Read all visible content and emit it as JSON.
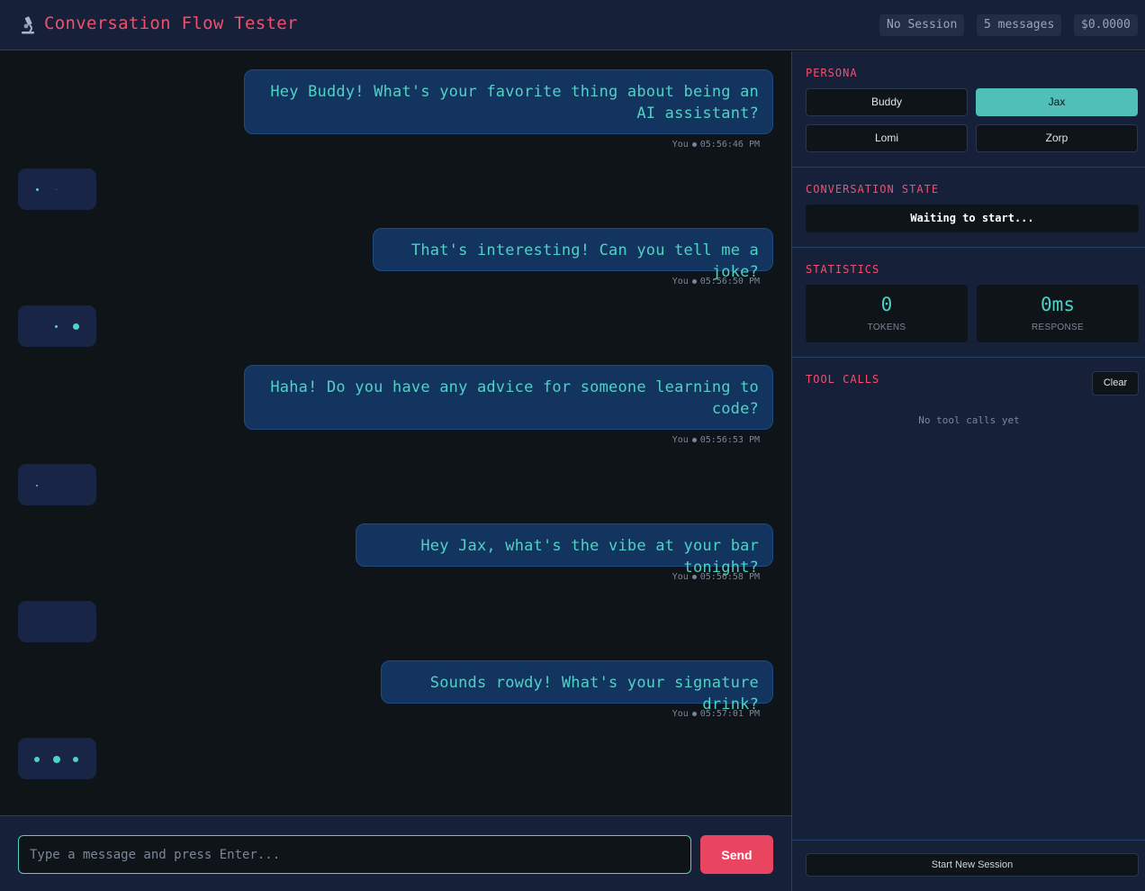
{
  "app": {
    "title": "Conversation Flow Tester",
    "logo_icon": "microscope-icon"
  },
  "header": {
    "session": "No Session",
    "messages": "5 messages",
    "cost": "$0.0000"
  },
  "chat": {
    "messages": [
      {
        "text": "Hey Buddy! What's your favorite thing about being an AI assistant?",
        "sender": "You",
        "time": "05:56:46 PM"
      },
      {
        "text": "That's interesting! Can you tell me a joke?",
        "sender": "You",
        "time": "05:56:50 PM"
      },
      {
        "text": "Haha! Do you have any advice for someone learning to code?",
        "sender": "You",
        "time": "05:56:53 PM"
      },
      {
        "text": "Hey Jax, what's the vibe at your bar tonight?",
        "sender": "You",
        "time": "05:56:58 PM"
      },
      {
        "text": "Sounds rowdy! What's your signature drink?",
        "sender": "You",
        "time": "05:57:01 PM"
      }
    ]
  },
  "input": {
    "placeholder": "Type a message and press Enter...",
    "send_label": "Send"
  },
  "sidebar": {
    "persona": {
      "title": "PERSONA",
      "options": [
        "Buddy",
        "Jax",
        "Lomi",
        "Zorp"
      ],
      "selected": "Jax"
    },
    "state": {
      "title": "CONVERSATION STATE",
      "value": "Waiting to start..."
    },
    "stats": {
      "title": "STATISTICS",
      "tokens_value": "0",
      "tokens_label": "TOKENS",
      "response_value": "0ms",
      "response_label": "RESPONSE"
    },
    "tools": {
      "title": "TOOL CALLS",
      "clear_label": "Clear",
      "empty_text": "No tool calls yet"
    },
    "new_session_label": "Start New Session"
  },
  "colors": {
    "accent_pink": "#f0506e",
    "accent_teal": "#4fd1c5",
    "send_button": "#ea4560",
    "user_bubble": "#143460",
    "panel": "#172039",
    "background": "#0f1419"
  }
}
